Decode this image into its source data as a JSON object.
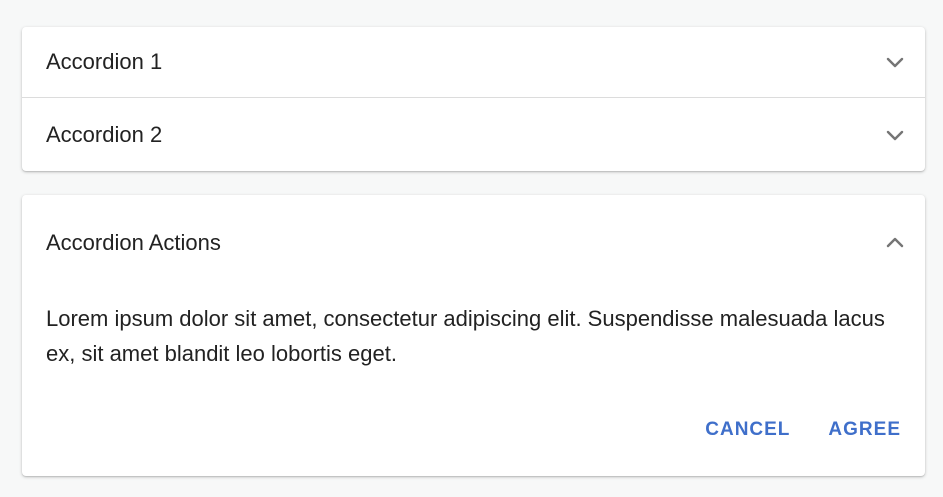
{
  "accordion1": {
    "title": "Accordion 1",
    "icon": "chevron-down-icon"
  },
  "accordion2": {
    "title": "Accordion 2",
    "icon": "chevron-down-icon"
  },
  "accordion3": {
    "title": "Accordion Actions",
    "icon": "chevron-up-icon",
    "details": "Lorem ipsum dolor sit amet, consectetur adipiscing elit. Suspendisse malesuada lacus ex, sit amet blandit leo lobortis eget.",
    "cancel_label": "Cancel",
    "agree_label": "Agree"
  },
  "colors": {
    "accent": "#3f6fca",
    "text": "#222222",
    "background": "#f7f8f8",
    "icon": "#757575"
  }
}
